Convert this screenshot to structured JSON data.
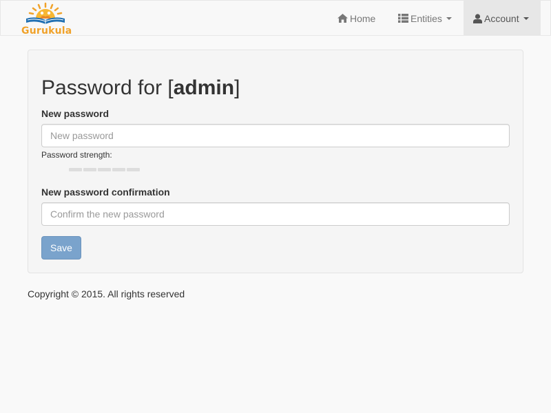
{
  "brand": {
    "name": "Gurukula",
    "logo_icon": "sun-over-book-logo",
    "color": "#f0a22a"
  },
  "nav": {
    "home": {
      "label": "Home",
      "icon": "home-icon"
    },
    "entities": {
      "label": "Entities",
      "icon": "list-icon"
    },
    "account": {
      "label": "Account",
      "icon": "user-icon",
      "active": true
    }
  },
  "page": {
    "title_prefix": "Password for [",
    "title_user": "admin",
    "title_suffix": "]"
  },
  "form": {
    "new_password": {
      "label": "New password",
      "placeholder": "New password",
      "value": ""
    },
    "strength": {
      "label": "Password strength:",
      "segments": 5,
      "level": 0
    },
    "confirm_password": {
      "label": "New password confirmation",
      "placeholder": "Confirm the new password",
      "value": ""
    },
    "save_label": "Save",
    "save_enabled": false,
    "save_color": "#7aa3cc"
  },
  "footer": {
    "text": "Copyright © 2015. All rights reserved"
  }
}
